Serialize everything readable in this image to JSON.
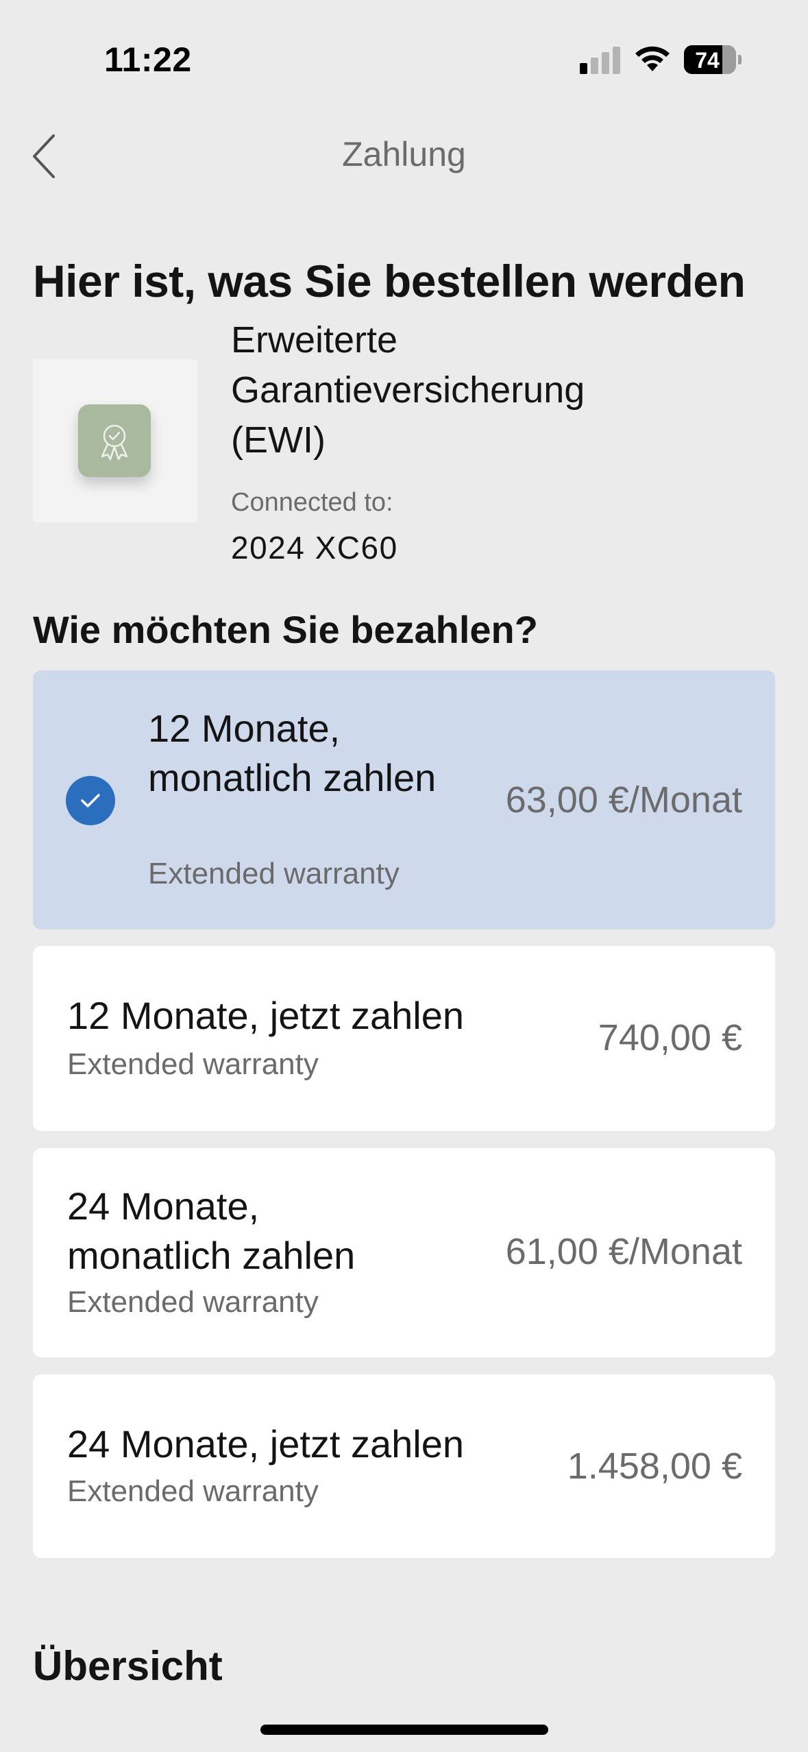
{
  "status_bar": {
    "time": "11:22",
    "battery_level": "74",
    "icons": [
      "signal-icon",
      "wifi-icon",
      "battery-icon"
    ]
  },
  "nav": {
    "title": "Zahlung",
    "back_icon": "chevron-left-icon"
  },
  "page_title": "Hier ist, was Sie bestellen werden",
  "product": {
    "name": "Erweiterte Garantieversicherung (EWI)",
    "connected_label": "Connected to:",
    "connected_value": "2024 XC60",
    "icon": "award-ribbon-icon"
  },
  "payment_section_title": "Wie möchten Sie bezahlen?",
  "payment_options": [
    {
      "title": "12 Monate, monatlich zahlen",
      "subtitle": "Extended warranty",
      "price": "63,00 €/Monat",
      "selected": true
    },
    {
      "title": "12 Monate, jetzt zahlen",
      "subtitle": "Extended warranty",
      "price": "740,00 €",
      "selected": false
    },
    {
      "title": "24 Monate, monatlich zahlen",
      "subtitle": "Extended warranty",
      "price": "61,00 €/Monat",
      "selected": false
    },
    {
      "title": "24 Monate, jetzt zahlen",
      "subtitle": "Extended warranty",
      "price": "1.458,00 €",
      "selected": false
    }
  ],
  "overview_title": "Übersicht",
  "colors": {
    "background": "#ebebeb",
    "selected_option": "#cfd9ec",
    "radio_selected": "#2a6ebd",
    "product_badge": "#a9b99e"
  }
}
